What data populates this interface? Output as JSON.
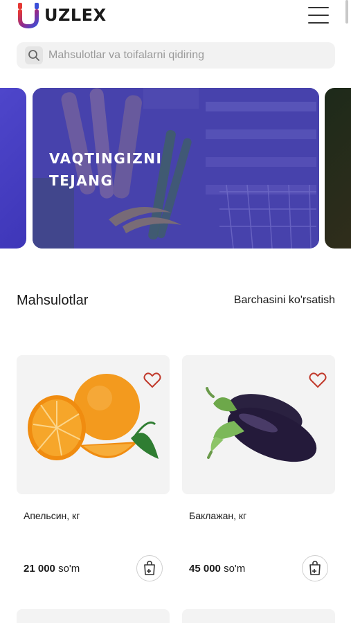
{
  "header": {
    "logo_text": "UZLEX",
    "menu_icon": "hamburger-icon"
  },
  "search": {
    "placeholder": "Mahsulotlar va toifalarni qidiring",
    "icon": "search-icon"
  },
  "banner": {
    "title_line1": "VAQTINGIZNI",
    "title_line2": "TEJANG",
    "overlay_color": "#4a44b0"
  },
  "products_section": {
    "title": "Mahsulotlar",
    "see_all_label": "Barchasini ko'rsatish"
  },
  "products": [
    {
      "name": "Апельсин, кг",
      "price_value": "21 000",
      "currency": "so'm",
      "image": "orange",
      "icons": [
        "heart-icon",
        "add-to-cart-icon"
      ]
    },
    {
      "name": "Баклажан, кг",
      "price_value": "45 000",
      "currency": "so'm",
      "image": "eggplant",
      "icons": [
        "heart-icon",
        "add-to-cart-icon"
      ]
    }
  ],
  "colors": {
    "accent_red": "#e53935",
    "accent_blue": "#3b4fd8",
    "heart": "#c0392b"
  }
}
